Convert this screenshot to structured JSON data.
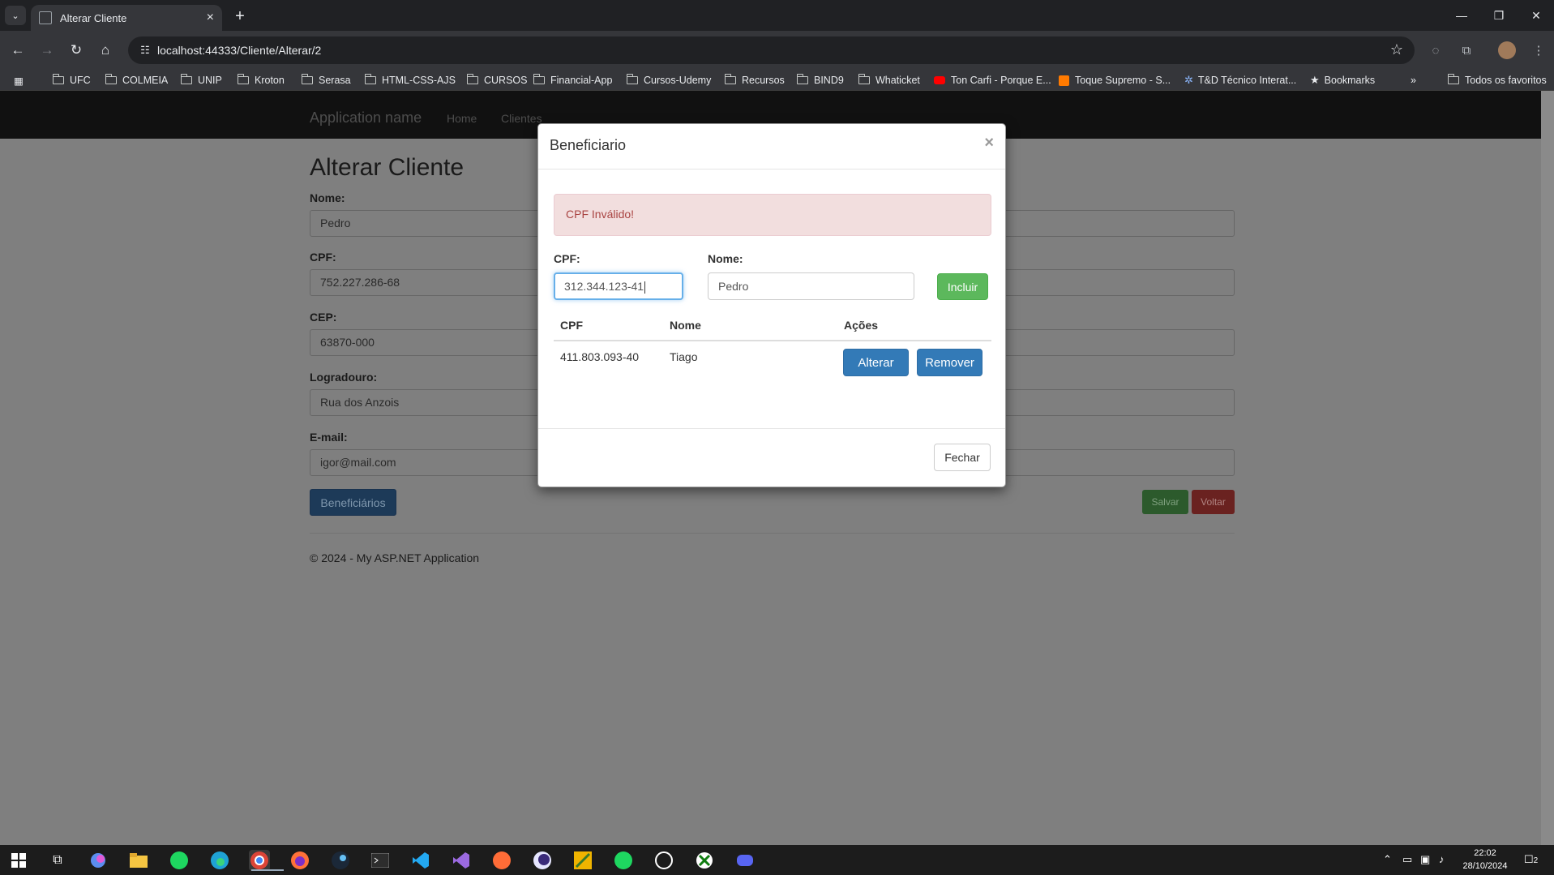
{
  "browser": {
    "tab_title": "Alterar Cliente",
    "url": "localhost:44333/Cliente/Alterar/2",
    "bookmarks": [
      "UFC",
      "COLMEIA",
      "UNIP",
      "Kroton",
      "Serasa",
      "HTML-CSS-AJS",
      "CURSOS",
      "Financial-App",
      "Cursos-Udemy",
      "Recursos",
      "BIND9",
      "Whaticket",
      "Ton Carfi - Porque E...",
      "Toque Supremo - S...",
      "T&D Técnico Interat...",
      "Bookmarks"
    ],
    "all_bookmarks": "Todos os favoritos",
    "overflow": "»"
  },
  "navbar": {
    "brand": "Application name",
    "links": [
      "Home",
      "Clientes"
    ]
  },
  "form": {
    "title": "Alterar Cliente",
    "fields": [
      {
        "label": "Nome:",
        "value": "Pedro"
      },
      {
        "label": "CPF:",
        "value": "752.227.286-68"
      },
      {
        "label": "CEP:",
        "value": "63870-000"
      },
      {
        "label": "Logradouro:",
        "value": "Rua dos Anzois"
      },
      {
        "label": "E-mail:",
        "value": "igor@mail.com"
      }
    ],
    "beneficiarios_button": "Beneficiários",
    "salvar_button": "Salvar",
    "voltar_button": "Voltar",
    "footer": "© 2024 - My ASP.NET Application"
  },
  "modal": {
    "title": "Beneficiario",
    "close": "×",
    "alert": "CPF Inválido!",
    "cpf_label": "CPF:",
    "cpf_value": "312.344.123-41",
    "nome_label": "Nome:",
    "nome_value": "Pedro",
    "incluir_button": "Incluir",
    "table": {
      "headers": [
        "CPF",
        "Nome",
        "Ações"
      ],
      "rows": [
        {
          "cpf": "411.803.093-40",
          "nome": "Tiago",
          "alterar": "Alterar",
          "remover": "Remover"
        }
      ]
    },
    "fechar_button": "Fechar"
  },
  "taskbar": {
    "time": "22:02",
    "date": "28/10/2024",
    "notifications": "2"
  }
}
